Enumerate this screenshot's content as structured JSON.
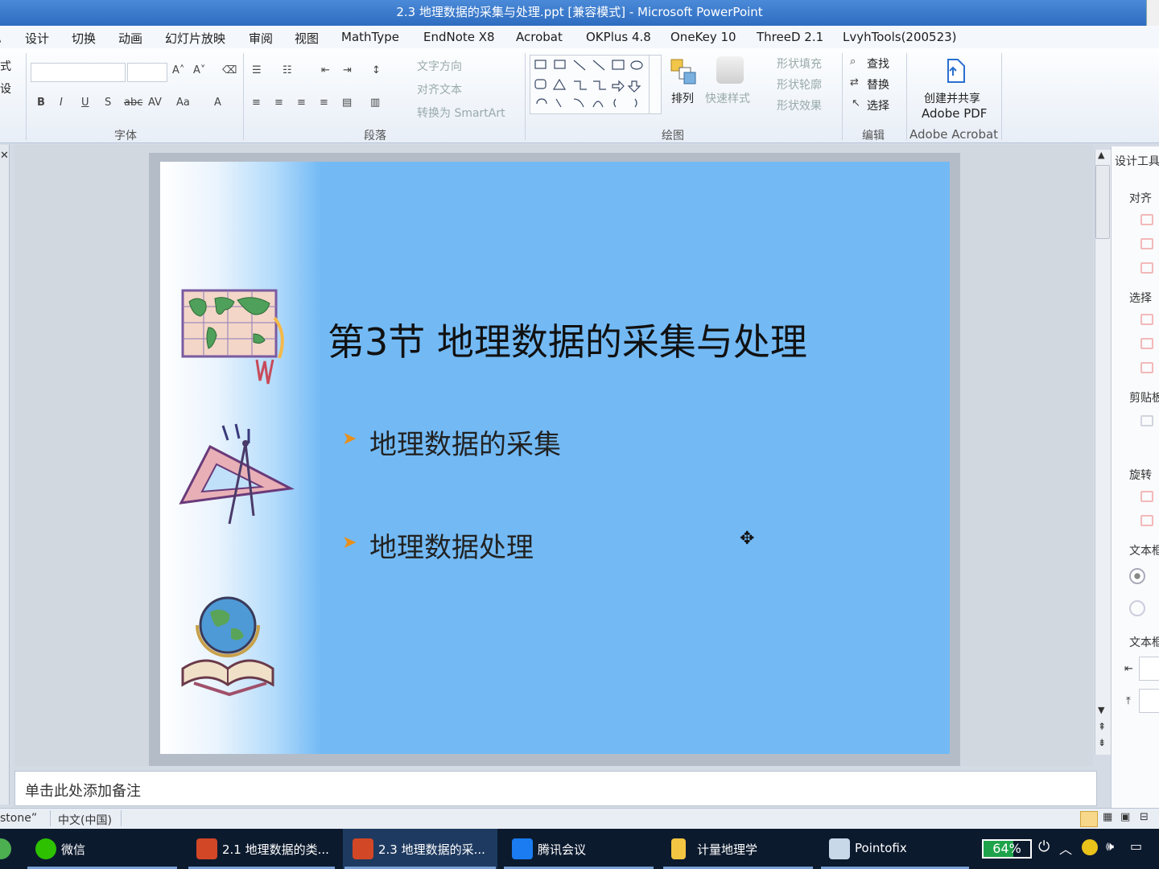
{
  "window": {
    "title": "2.3 地理数据的采集与处理.ppt [兼容模式] - Microsoft PowerPoint"
  },
  "menu": [
    "设计",
    "切换",
    "动画",
    "幻灯片放映",
    "审阅",
    "视图",
    "MathType",
    "EndNote X8",
    "Acrobat",
    "OKPlus 4.8",
    "OneKey 10",
    "ThreeD 2.1",
    "LvyhTools(200523)"
  ],
  "ribbon": {
    "partial_left": [
      "式",
      "设"
    ],
    "groups": {
      "font": "字体",
      "paragraph": "段落",
      "drawing": "绘图",
      "editing": "编辑",
      "acrobat": "Adobe Acrobat"
    },
    "paragraph_items": [
      "文字方向",
      "对齐文本",
      "转换为 SmartArt"
    ],
    "drawing_items": {
      "arrange": "排列",
      "quick_styles": "快速样式",
      "fill": "形状填充",
      "outline": "形状轮廓",
      "effects": "形状效果"
    },
    "editing_items": [
      "查找",
      "替换",
      "选择"
    ],
    "acrobat_items": [
      "创建并共享",
      "Adobe PDF"
    ]
  },
  "slide": {
    "title": "第3节  地理数据的采集与处理",
    "bullets": [
      "地理数据的采集",
      "地理数据处理"
    ]
  },
  "notes": {
    "placeholder": "单击此处添加备注"
  },
  "right_pane": {
    "header": "设计工具",
    "sections": [
      "对齐",
      "选择",
      "剪贴板",
      "旋转",
      "文本框",
      "文本框"
    ]
  },
  "status": {
    "theme": "stone”",
    "language": "中文(中国)"
  },
  "taskbar": {
    "items": [
      {
        "label": "微信",
        "icon": "wechat-icon",
        "color": "#2dc100"
      },
      {
        "label": "2.1 地理数据的类...",
        "icon": "powerpoint-icon",
        "color": "#d24726"
      },
      {
        "label": "2.3 地理数据的采...",
        "icon": "powerpoint-icon",
        "color": "#d24726",
        "active": true
      },
      {
        "label": "腾讯会议",
        "icon": "tencent-meeting-icon",
        "color": "#1a7cf0"
      },
      {
        "label": "计量地理学",
        "icon": "folder-icon",
        "color": "#f4c542"
      },
      {
        "label": "Pointofix",
        "icon": "pointofix-icon",
        "color": "#c8d8e8"
      }
    ],
    "battery": "64%"
  }
}
